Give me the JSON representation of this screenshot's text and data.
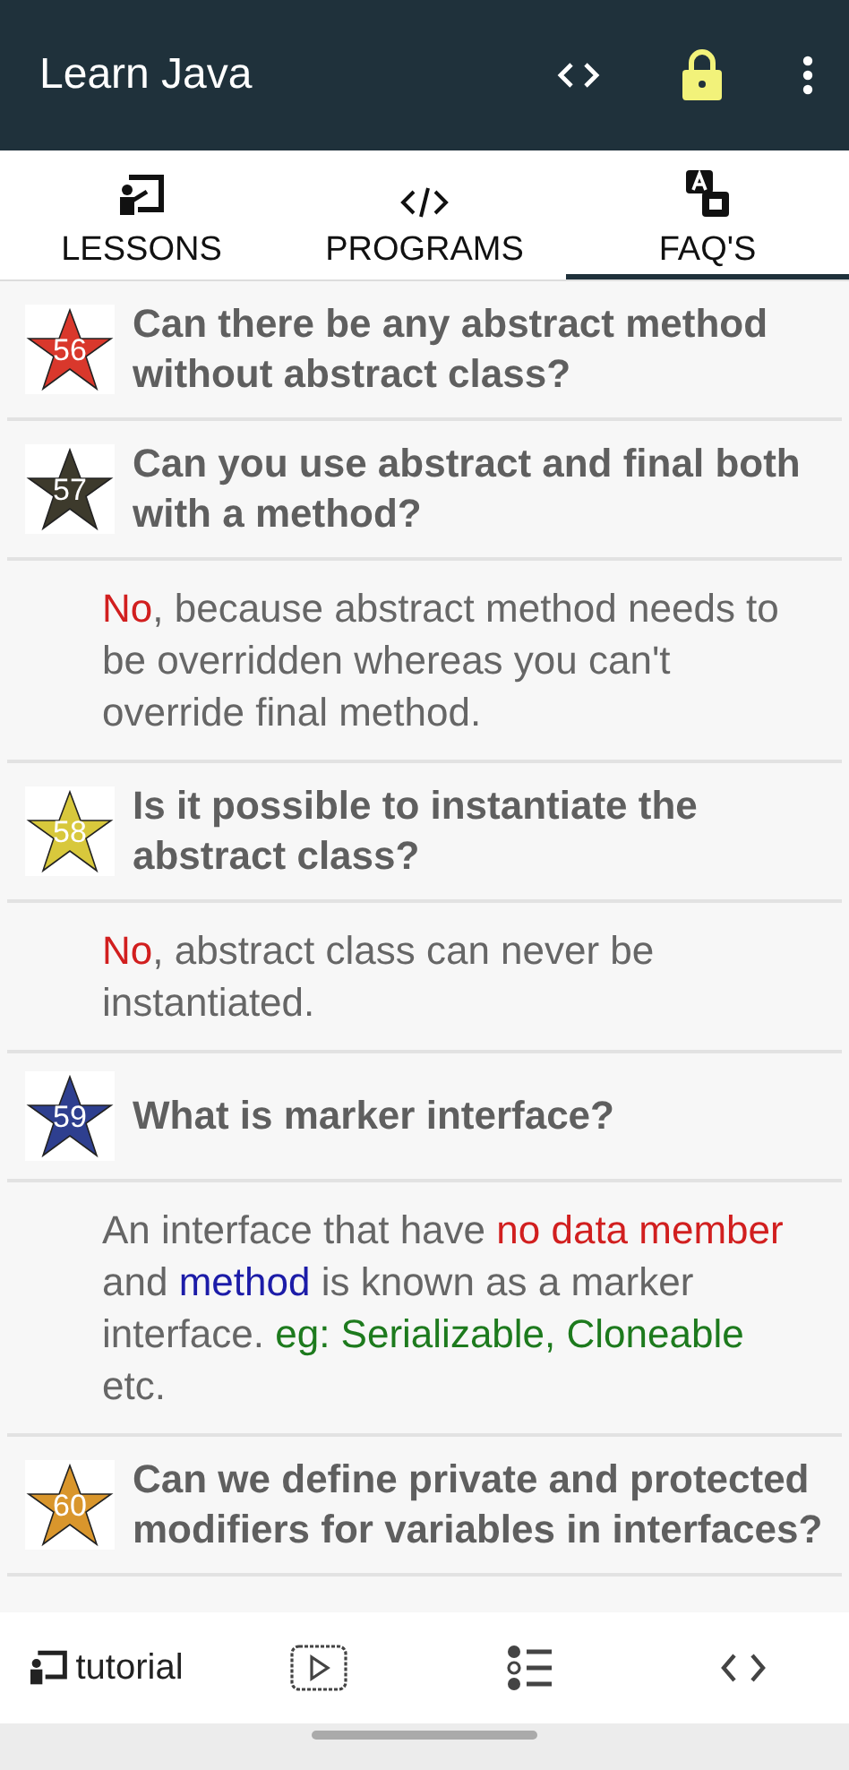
{
  "app_bar": {
    "title": "Learn Java"
  },
  "tabs": [
    {
      "label": "LESSONS",
      "kind": "lessons",
      "selected": false
    },
    {
      "label": "PROGRAMS",
      "kind": "programs",
      "selected": false
    },
    {
      "label": "FAQ'S",
      "kind": "faq",
      "selected": true
    }
  ],
  "items": [
    {
      "kind": "question",
      "number": "56",
      "color": "#d9382c",
      "text": "Can there be any abstract method without abstract class?"
    },
    {
      "kind": "question",
      "number": "57",
      "color": "#3d3a2c",
      "text": "Can you use abstract and final both with a method?"
    },
    {
      "kind": "answer",
      "segments": [
        {
          "text": "No",
          "color": "#d11f1f"
        },
        {
          "text": ", because abstract method needs to be overridden whereas you can't override final method.",
          "color": "#666666"
        }
      ]
    },
    {
      "kind": "question",
      "number": "58",
      "color": "#d8c83c",
      "text": "Is it possible to instantiate the abstract class?"
    },
    {
      "kind": "answer",
      "segments": [
        {
          "text": "No",
          "color": "#d11f1f"
        },
        {
          "text": ", abstract class can never be instantiated.",
          "color": "#666666"
        }
      ]
    },
    {
      "kind": "question",
      "number": "59",
      "color": "#2e3f8f",
      "text": "What is marker interface?"
    },
    {
      "kind": "answer",
      "segments": [
        {
          "text": "An interface that have ",
          "color": "#666666"
        },
        {
          "text": "no data member",
          "color": "#d11f1f"
        },
        {
          "text": " and ",
          "color": "#666666"
        },
        {
          "text": "method",
          "color": "#1c1ca8"
        },
        {
          "text": " is known as a marker interface. ",
          "color": "#666666"
        },
        {
          "text": "eg: Serializable, Cloneable",
          "color": "#1d7a1d"
        },
        {
          "text": " etc.",
          "color": "#666666"
        }
      ]
    },
    {
      "kind": "question",
      "number": "60",
      "color": "#d9962c",
      "text": "Can we define private and protected modifiers for variables in interfaces?"
    }
  ],
  "bottom_nav": [
    {
      "kind": "tutorial",
      "label": "tutorial"
    },
    {
      "kind": "video"
    },
    {
      "kind": "list"
    },
    {
      "kind": "code"
    }
  ]
}
